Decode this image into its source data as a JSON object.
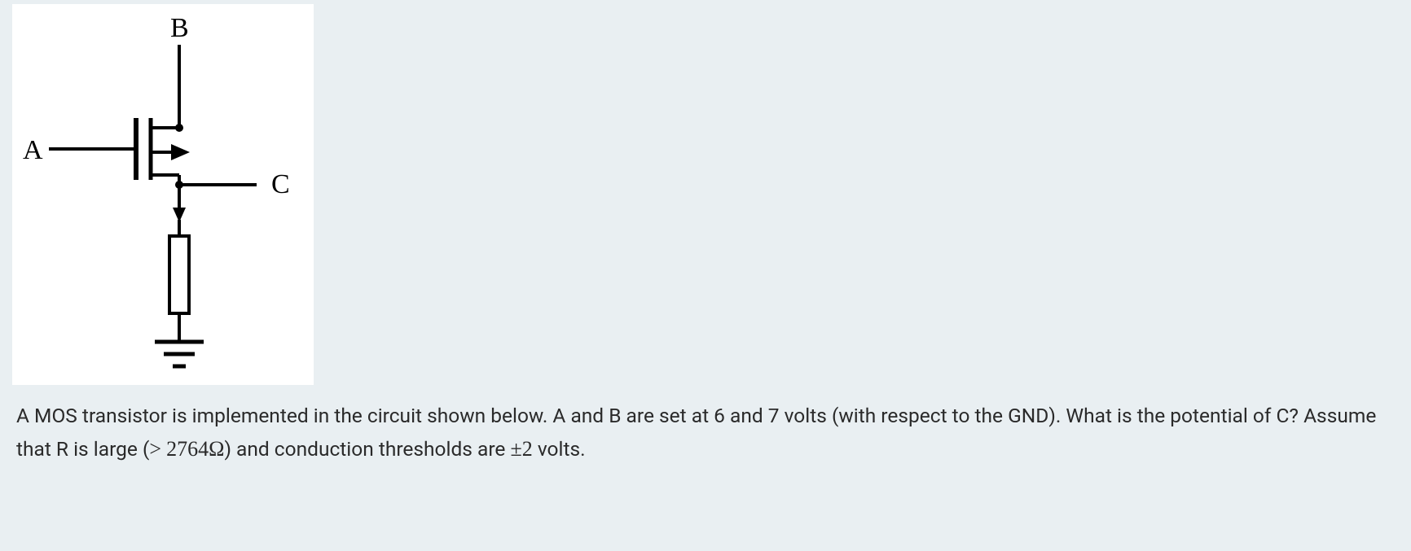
{
  "circuit": {
    "labels": {
      "gate": "A",
      "drain": "B",
      "source_output": "C"
    }
  },
  "question": {
    "text_part1": "A MOS transistor is implemented in the circuit shown below. A and B are set at 6 and 7 volts (with respect to the GND). What is the potential of C? Assume that R is large (",
    "gt_symbol": ">",
    "resistance_value": "2764",
    "text_part2": ") and conduction thresholds are ",
    "threshold_value": "2",
    "text_part3": " volts."
  }
}
